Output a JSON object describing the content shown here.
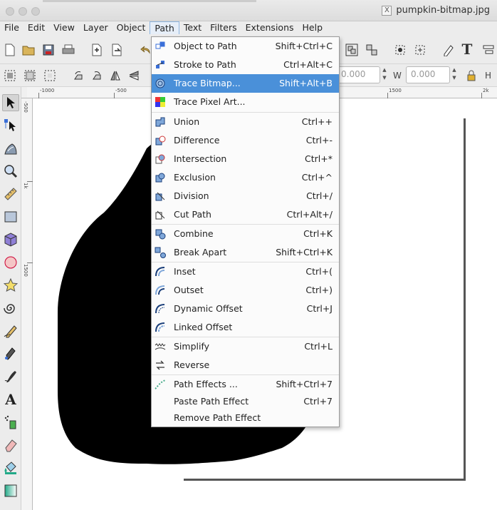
{
  "window": {
    "title": "pumpkin-bitmap.jpg",
    "title_icon": "x11-icon"
  },
  "menubar": [
    "File",
    "Edit",
    "View",
    "Layer",
    "Object",
    "Path",
    "Text",
    "Filters",
    "Extensions",
    "Help"
  ],
  "active_menu": "Path",
  "path_menu": {
    "items": [
      {
        "label": "Object to Path",
        "shortcut": "Shift+Ctrl+C",
        "icon": "object-to-path-icon"
      },
      {
        "label": "Stroke to Path",
        "shortcut": "Ctrl+Alt+C",
        "icon": "stroke-to-path-icon"
      },
      {
        "label": "Trace Bitmap...",
        "shortcut": "Shift+Alt+B",
        "icon": "trace-bitmap-icon",
        "highlighted": true
      },
      {
        "label": "Trace Pixel Art...",
        "shortcut": "",
        "icon": "trace-pixel-art-icon"
      },
      {
        "label": "Union",
        "shortcut": "Ctrl++",
        "icon": "union-icon"
      },
      {
        "label": "Difference",
        "shortcut": "Ctrl+-",
        "icon": "difference-icon"
      },
      {
        "label": "Intersection",
        "shortcut": "Ctrl+*",
        "icon": "intersection-icon"
      },
      {
        "label": "Exclusion",
        "shortcut": "Ctrl+^",
        "icon": "exclusion-icon"
      },
      {
        "label": "Division",
        "shortcut": "Ctrl+/",
        "icon": "division-icon"
      },
      {
        "label": "Cut Path",
        "shortcut": "Ctrl+Alt+/",
        "icon": "cut-path-icon"
      },
      {
        "label": "Combine",
        "shortcut": "Ctrl+K",
        "icon": "combine-icon"
      },
      {
        "label": "Break Apart",
        "shortcut": "Shift+Ctrl+K",
        "icon": "break-apart-icon"
      },
      {
        "label": "Inset",
        "shortcut": "Ctrl+(",
        "icon": "inset-icon"
      },
      {
        "label": "Outset",
        "shortcut": "Ctrl+)",
        "icon": "outset-icon"
      },
      {
        "label": "Dynamic Offset",
        "shortcut": "Ctrl+J",
        "icon": "dynamic-offset-icon"
      },
      {
        "label": "Linked Offset",
        "shortcut": "",
        "icon": "linked-offset-icon"
      },
      {
        "label": "Simplify",
        "shortcut": "Ctrl+L",
        "icon": "simplify-icon"
      },
      {
        "label": "Reverse",
        "shortcut": "",
        "icon": "reverse-icon"
      },
      {
        "label": "Path Effects ...",
        "shortcut": "Shift+Ctrl+7",
        "icon": "path-effects-icon"
      },
      {
        "label": "Paste Path Effect",
        "shortcut": "Ctrl+7",
        "icon": ""
      },
      {
        "label": "Remove Path Effect",
        "shortcut": "",
        "icon": ""
      }
    ]
  },
  "toolbar2": {
    "x_value": "0.000",
    "w_label": "W",
    "w_value": "0.000",
    "h_label": "H"
  },
  "rulers": {
    "h_labels": [
      "-1000",
      "-500",
      "1500",
      "2k"
    ],
    "v_labels": [
      "-500",
      "1k",
      "1500"
    ]
  },
  "colors": {
    "highlight": "#4a90d9",
    "shape": "#000000",
    "canvas": "#ffffff",
    "chrome": "#ececec"
  }
}
